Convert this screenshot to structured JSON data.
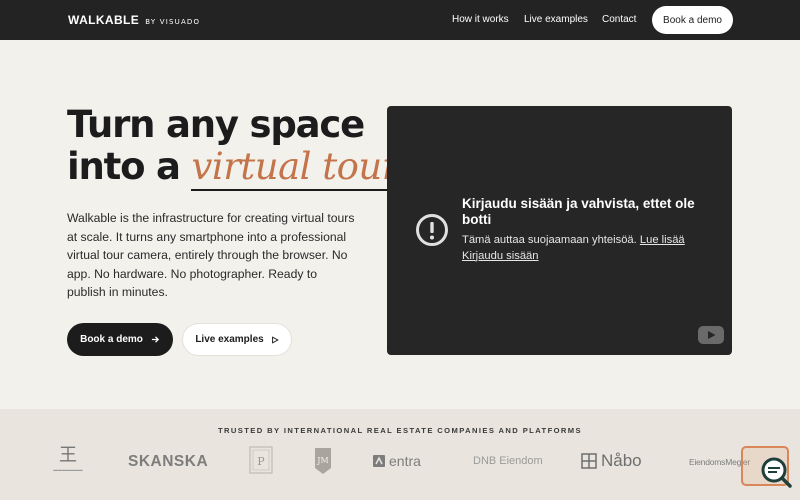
{
  "header": {
    "brand_name": "WALKABLE",
    "brand_by": "BY VISUADO",
    "nav": [
      "How it works",
      "Live examples",
      "Contact"
    ],
    "cta": "Book a demo"
  },
  "hero": {
    "title_line1": "Turn any space",
    "title_line2_prefix": "into a",
    "title_line2_accent": "virtual tour",
    "description": "Walkable is the infrastructure for creating virtual tours at scale. It turns any smartphone into a professional virtual tour camera, entirely through the browser. No app. No hardware. No photographer. Ready to publish in minutes.",
    "primary_button": "Book a demo",
    "secondary_button": "Live examples"
  },
  "video": {
    "title": "Kirjaudu sisään ja vahvista, ettet ole botti",
    "subtitle": "Tämä auttaa suojaamaan yhteisöä.",
    "learn_more": "Lue lisää",
    "sign_in": "Kirjaudu sisään"
  },
  "trusted": {
    "label": "TRUSTED BY INTERNATIONAL REAL ESTATE COMPANIES AND PLATFORMS",
    "logos": [
      "SKANSKA",
      "entra",
      "DNB Eiendom",
      "Nåbo",
      "EiendomsMegler"
    ]
  },
  "colors": {
    "header_bg": "#232323",
    "page_bg": "#f3f1ec",
    "accent": "#c4744a",
    "video_bg": "#262626"
  },
  "icons": [
    "arrow-right-icon",
    "play-icon",
    "alert-circle-icon",
    "youtube-icon",
    "search-icon"
  ]
}
